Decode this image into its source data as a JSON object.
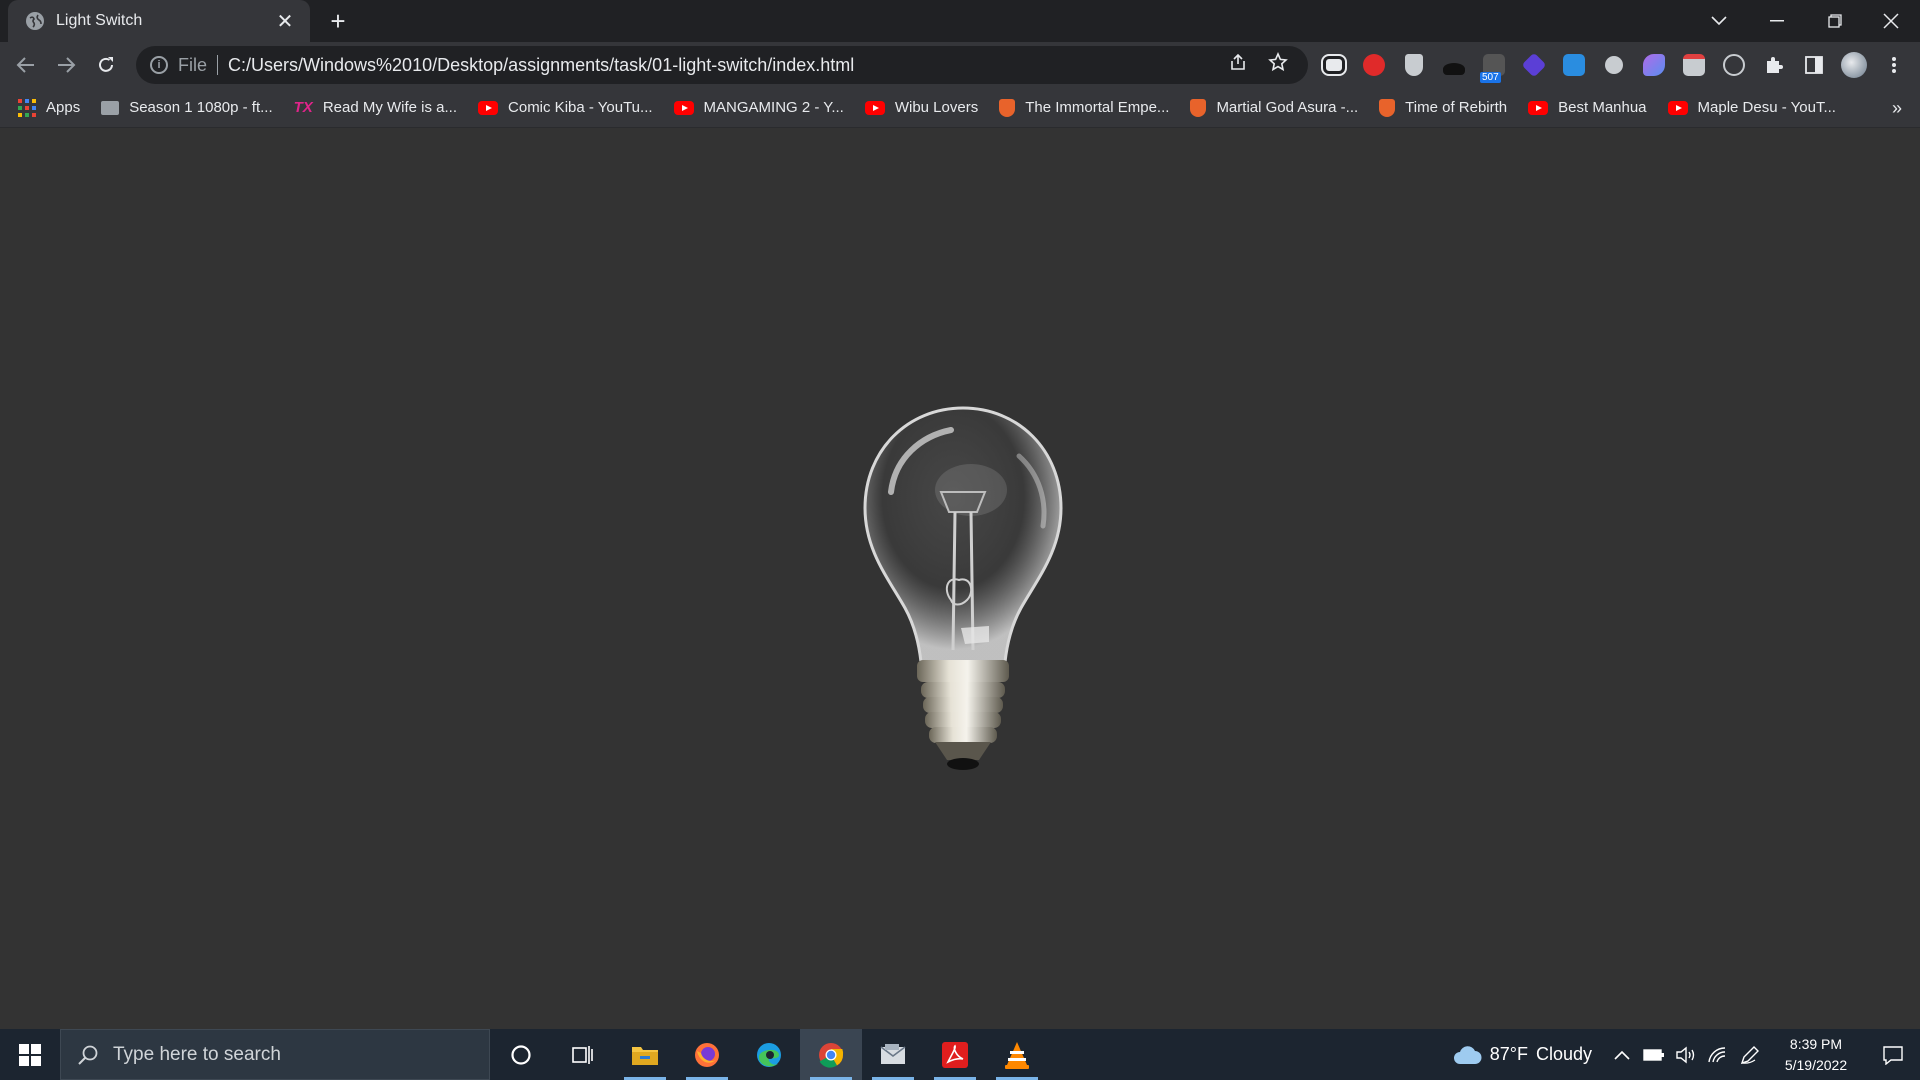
{
  "browser": {
    "tab": {
      "title": "Light Switch",
      "close": "✕"
    },
    "new_tab": "+",
    "address_bar": {
      "scheme_label": "File",
      "url": "C:/Users/Windows%2010/Desktop/assignments/task/01-light-switch/index.html"
    },
    "extension_badge": "507",
    "bookmarks": [
      {
        "label": "Apps",
        "icon": "apps-grid-icon"
      },
      {
        "label": "Season 1 1080p - ft...",
        "icon": "folder-icon"
      },
      {
        "label": "Read My Wife is a...",
        "icon": "tx-icon"
      },
      {
        "label": "Comic Kiba - YouTu...",
        "icon": "youtube-icon"
      },
      {
        "label": "MANGAMING 2 - Y...",
        "icon": "youtube-icon"
      },
      {
        "label": "Wibu Lovers",
        "icon": "youtube-icon"
      },
      {
        "label": "The Immortal Empe...",
        "icon": "shield-icon"
      },
      {
        "label": "Martial God Asura -...",
        "icon": "shield-icon"
      },
      {
        "label": "Time of Rebirth",
        "icon": "shield-icon"
      },
      {
        "label": "Best Manhua",
        "icon": "youtube-icon"
      },
      {
        "label": "Maple Desu - YouT...",
        "icon": "youtube-icon"
      }
    ],
    "bookmarks_overflow": "»"
  },
  "page": {
    "image": "light-bulb-off"
  },
  "taskbar": {
    "search_placeholder": "Type here to search",
    "weather": {
      "temp": "87°F",
      "condition": "Cloudy"
    },
    "clock": {
      "time": "8:39 PM",
      "date": "5/19/2022"
    }
  },
  "colors": {
    "page_bg": "#333333",
    "browser_frame": "#202124",
    "toolbar": "#35363a",
    "taskbar": "#1c2530"
  }
}
